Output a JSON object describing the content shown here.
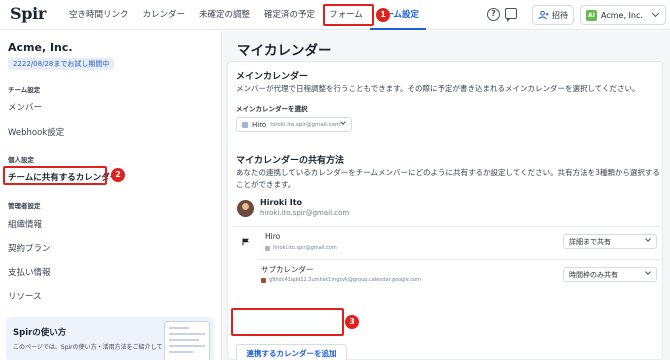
{
  "app": {
    "logo": "Spir"
  },
  "nav": {
    "items": [
      "空き時間リンク",
      "カレンダー",
      "未確定の調整",
      "確定済の予定",
      "フォーム",
      "チーム設定"
    ],
    "active_index": 5
  },
  "header": {
    "help_icon": "question-circle-icon",
    "chat_icon": "chat-bubble-icon",
    "invite_label": "招待",
    "account_avatar": "AI",
    "account_name": "Acme, Inc."
  },
  "sidebar": {
    "org_name": "Acme, Inc.",
    "trial_text": "2222/08/28までお試し期間中",
    "sections": {
      "team": "チーム設定",
      "personal": "個人設定",
      "admin": "管理者設定"
    },
    "team_items": [
      "メンバー",
      "Webhook設定"
    ],
    "personal_items": [
      "チームに共有するカレンダー"
    ],
    "admin_items": [
      "組織情報",
      "契約プラン",
      "支払い情報",
      "リソース"
    ],
    "promo": {
      "title": "Spirの使い方",
      "text": "このページでは、Spirの使い方・活用方法をご紹介しています。"
    }
  },
  "main": {
    "page_title": "マイカレンダー",
    "main_calendar": {
      "heading": "メインカレンダー",
      "description": "メンバーが代理で日程調整を行うこともできます。その際に予定が書き込まれるメインカレンダーを選択してください。",
      "select_label": "メインカレンダーを選択",
      "selected_name": "Hiro",
      "selected_email": "hiroki.ito.spir@gmail.com"
    },
    "sharing": {
      "heading": "マイカレンダーの共有方法",
      "description_line1": "あなたの連携しているカレンダーをチームメンバーにどのように共有するか設定してください。共有方法を3種類から選択する",
      "description_line2": "ことができます。",
      "user_name": "Hiroki Ito",
      "user_email": "hiroki.ito.spir@gmail.com",
      "calendars": [
        {
          "name": "Hiro",
          "id": "hiroki.ito.spir@gmail.com",
          "share": "詳細まで共有",
          "color": "#a3b8d9",
          "primary": true
        },
        {
          "name": "サブカレンダー",
          "id": "g9hdc41qdd12.3umhsk1mgsvk@group.calendar.google.com",
          "share": "時間枠のみ共有",
          "color": "#a0522d",
          "primary": false
        }
      ]
    },
    "add_button": "連携するカレンダーを追加"
  },
  "annotations": [
    "1",
    "2",
    "3"
  ],
  "colors": {
    "accent": "#1d5fd6",
    "annotation": "#e0201c"
  }
}
